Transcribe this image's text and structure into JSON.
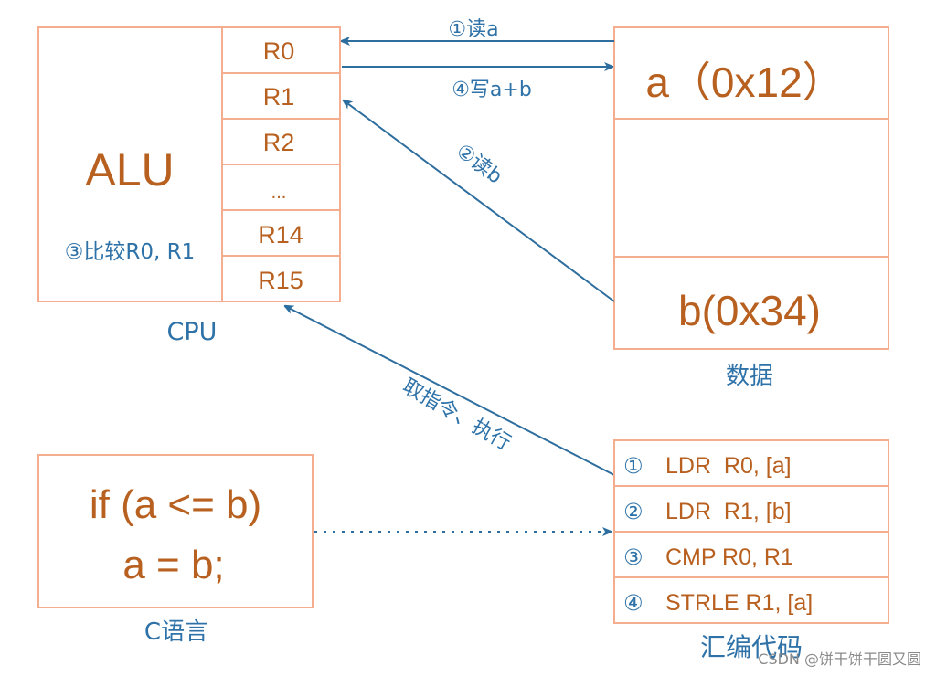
{
  "colors": {
    "box_border": "#f5ad90",
    "text_primary": "#b8601f",
    "arrow": "#2e6e9e",
    "label": "#2e72a8"
  },
  "cpu": {
    "label": "CPU",
    "alu": "ALU",
    "alu_note": "③比较R0, R1",
    "registers": [
      "R0",
      "R1",
      "R2",
      "...",
      "R14",
      "R15"
    ]
  },
  "memory": {
    "label": "数据",
    "a": "a（0x12）",
    "b": "b(0x34)"
  },
  "arrows": {
    "read_a": "①读a",
    "write_ab": "④写a+b",
    "read_b": "②读b",
    "fetch": "取指令、执行"
  },
  "c_code": {
    "label": "C语言",
    "lines": [
      "if (a <= b)",
      "a = b;"
    ]
  },
  "asm": {
    "label": "汇编代码",
    "lines": [
      {
        "num": "①",
        "text": "LDR  R0, [a]"
      },
      {
        "num": "②",
        "text": "LDR  R1, [b]"
      },
      {
        "num": "③",
        "text": "CMP R0, R1"
      },
      {
        "num": "④",
        "text": "STRLE R1, [a]"
      }
    ]
  },
  "watermark": "CSDN @饼干饼干圆又圆"
}
